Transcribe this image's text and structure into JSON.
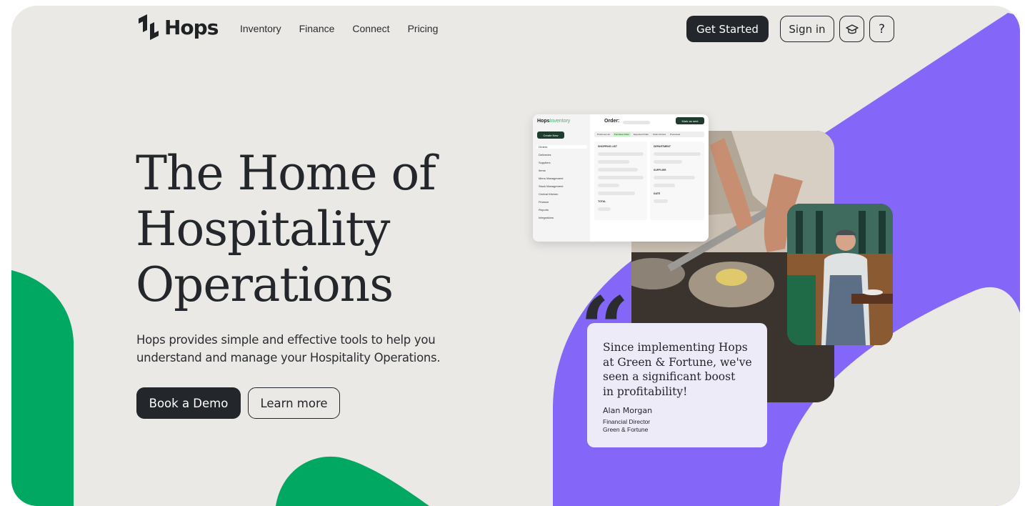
{
  "brand": {
    "name": "Hops"
  },
  "nav": {
    "links": [
      "Inventory",
      "Finance",
      "Connect",
      "Pricing"
    ],
    "get_started": "Get Started",
    "sign_in": "Sign in",
    "help": "?"
  },
  "hero": {
    "title_lines": [
      "The Home of",
      "Hospitality",
      "Operations"
    ],
    "subtitle_lines": [
      "Hops provides simple and effective tools to help you",
      "understand and manage your Hospitality Operations."
    ],
    "book_demo": "Book a Demo",
    "learn_more": "Learn more"
  },
  "app_preview": {
    "logo_main": "Hops",
    "logo_sub": "Inventory",
    "create_button": "Create New",
    "sidebar": [
      "Orders",
      "Deliveries",
      "Suppliers",
      "Items",
      "Menu Management",
      "Stock Management",
      "Central Kitchen",
      "Finance",
      "Reports",
      "Integrations"
    ],
    "order_title": "Order:",
    "mark_button": "Mark as sent",
    "tabs": [
      "Proforma List",
      "Purchase Order",
      "Expected Order",
      "Order Arrived",
      "Processed"
    ],
    "active_tab": 1,
    "shopping_list": "SHOPPING LIST",
    "total": "TOTAL",
    "department": "DEPARTMENT",
    "supplier": "SUPPLIER",
    "date": "DATE"
  },
  "testimonial": {
    "marks": "“",
    "quote_lines": [
      "Since implementing Hops",
      "at Green & Fortune, we've",
      "seen a significant boost",
      "in profitability!"
    ],
    "name": "Alan Morgan",
    "role": "Financial Director",
    "company": "Green & Fortune"
  },
  "colors": {
    "background": "#ebe9e6",
    "green": "#01a862",
    "purple": "#8467f8",
    "dark": "#23262a"
  },
  "icons": {
    "logo": "hops-logo-icon",
    "academy": "graduation-cap-icon",
    "quote": "quote-icon"
  }
}
